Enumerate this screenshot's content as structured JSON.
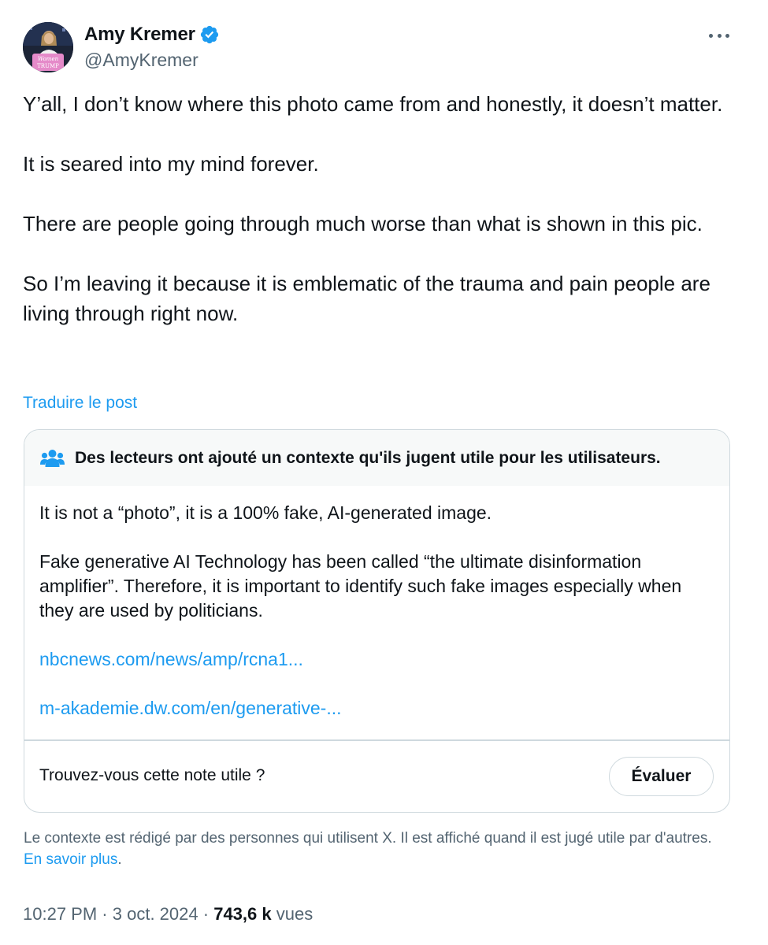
{
  "author": {
    "display_name": "Amy Kremer",
    "handle": "@AmyKremer",
    "verified": true,
    "avatar_sign_text": [
      "Women",
      "TRUMP"
    ]
  },
  "post": {
    "paragraphs": [
      "Y’all, I don’t know where this photo came from and honestly, it doesn’t matter.",
      "It is seared into my mind forever.",
      "There are people going through much worse than what is shown in this pic.",
      "So I’m leaving it because it is emblematic of the trauma and pain people are living through right now."
    ],
    "translate_label": "Traduire le post"
  },
  "note": {
    "header": "Des lecteurs ont ajouté un contexte qu'ils jugent utile pour les utilisateurs.",
    "body": [
      "It is not a “photo”, it is a 100% fake, AI-generated image.",
      "Fake generative AI Technology has been called “the ultimate disinformation amplifier”. Therefore, it is important to identify such fake images especially when they are used by politicians."
    ],
    "links": [
      "nbcnews.com/news/amp/rcna1...",
      "m-akademie.dw.com/en/generative-..."
    ],
    "question": "Trouvez-vous cette note utile ?",
    "rate_label": "Évaluer"
  },
  "context_info": {
    "text": "Le contexte est rédigé par des personnes qui utilisent X. Il est affiché quand il est jugé utile par d'autres.",
    "learn_more": "En savoir plus",
    "trailing": "."
  },
  "meta": {
    "time": "10:27 PM",
    "separator": "·",
    "date": "3 oct. 2024",
    "views_count": "743,6 k",
    "views_label": "vues"
  },
  "colors": {
    "text_primary": "#0f1419",
    "text_secondary": "#536471",
    "link": "#1d9bf0",
    "border": "#cfd9de",
    "note_header_bg": "#f7f9f9",
    "verified_badge": "#1d9bf0"
  },
  "icons": [
    "verified-badge-icon",
    "more-options-icon",
    "community-notes-icon"
  ]
}
